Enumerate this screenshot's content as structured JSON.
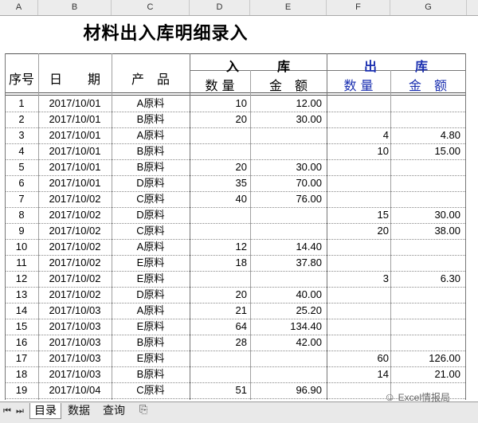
{
  "column_headers": [
    "A",
    "B",
    "C",
    "D",
    "E",
    "F",
    "G"
  ],
  "title": "材料出入库明细录入",
  "header": {
    "seq": "序号",
    "date": "日　　期",
    "product": "产　品",
    "in_group": "入　　　库",
    "out_group": "出　　　库",
    "in_qty": "数 量",
    "in_amt": "金　额",
    "out_qty": "数 量",
    "out_amt": "金　额"
  },
  "rows": [
    {
      "seq": "1",
      "date": "2017/10/01",
      "product": "A原料",
      "in_qty": "10",
      "in_amt": "12.00",
      "out_qty": "",
      "out_amt": ""
    },
    {
      "seq": "2",
      "date": "2017/10/01",
      "product": "B原料",
      "in_qty": "20",
      "in_amt": "30.00",
      "out_qty": "",
      "out_amt": ""
    },
    {
      "seq": "3",
      "date": "2017/10/01",
      "product": "A原料",
      "in_qty": "",
      "in_amt": "",
      "out_qty": "4",
      "out_amt": "4.80"
    },
    {
      "seq": "4",
      "date": "2017/10/01",
      "product": "B原料",
      "in_qty": "",
      "in_amt": "",
      "out_qty": "10",
      "out_amt": "15.00"
    },
    {
      "seq": "5",
      "date": "2017/10/01",
      "product": "B原料",
      "in_qty": "20",
      "in_amt": "30.00",
      "out_qty": "",
      "out_amt": ""
    },
    {
      "seq": "6",
      "date": "2017/10/01",
      "product": "D原料",
      "in_qty": "35",
      "in_amt": "70.00",
      "out_qty": "",
      "out_amt": ""
    },
    {
      "seq": "7",
      "date": "2017/10/02",
      "product": "C原料",
      "in_qty": "40",
      "in_amt": "76.00",
      "out_qty": "",
      "out_amt": ""
    },
    {
      "seq": "8",
      "date": "2017/10/02",
      "product": "D原料",
      "in_qty": "",
      "in_amt": "",
      "out_qty": "15",
      "out_amt": "30.00"
    },
    {
      "seq": "9",
      "date": "2017/10/02",
      "product": "C原料",
      "in_qty": "",
      "in_amt": "",
      "out_qty": "20",
      "out_amt": "38.00"
    },
    {
      "seq": "10",
      "date": "2017/10/02",
      "product": "A原料",
      "in_qty": "12",
      "in_amt": "14.40",
      "out_qty": "",
      "out_amt": ""
    },
    {
      "seq": "11",
      "date": "2017/10/02",
      "product": "E原料",
      "in_qty": "18",
      "in_amt": "37.80",
      "out_qty": "",
      "out_amt": ""
    },
    {
      "seq": "12",
      "date": "2017/10/02",
      "product": "E原料",
      "in_qty": "",
      "in_amt": "",
      "out_qty": "3",
      "out_amt": "6.30"
    },
    {
      "seq": "13",
      "date": "2017/10/02",
      "product": "D原料",
      "in_qty": "20",
      "in_amt": "40.00",
      "out_qty": "",
      "out_amt": ""
    },
    {
      "seq": "14",
      "date": "2017/10/03",
      "product": "A原料",
      "in_qty": "21",
      "in_amt": "25.20",
      "out_qty": "",
      "out_amt": ""
    },
    {
      "seq": "15",
      "date": "2017/10/03",
      "product": "E原料",
      "in_qty": "64",
      "in_amt": "134.40",
      "out_qty": "",
      "out_amt": ""
    },
    {
      "seq": "16",
      "date": "2017/10/03",
      "product": "B原料",
      "in_qty": "28",
      "in_amt": "42.00",
      "out_qty": "",
      "out_amt": ""
    },
    {
      "seq": "17",
      "date": "2017/10/03",
      "product": "E原料",
      "in_qty": "",
      "in_amt": "",
      "out_qty": "60",
      "out_amt": "126.00"
    },
    {
      "seq": "18",
      "date": "2017/10/03",
      "product": "B原料",
      "in_qty": "",
      "in_amt": "",
      "out_qty": "14",
      "out_amt": "21.00"
    },
    {
      "seq": "19",
      "date": "2017/10/04",
      "product": "C原料",
      "in_qty": "51",
      "in_amt": "96.90",
      "out_qty": "",
      "out_amt": ""
    }
  ],
  "sheet_tabs": [
    "目录",
    "数据",
    "查询"
  ],
  "active_tab": "目录",
  "watermark": "Excel情报局",
  "colors": {
    "out_header": "#1a2fb0",
    "grid": "#888888"
  }
}
